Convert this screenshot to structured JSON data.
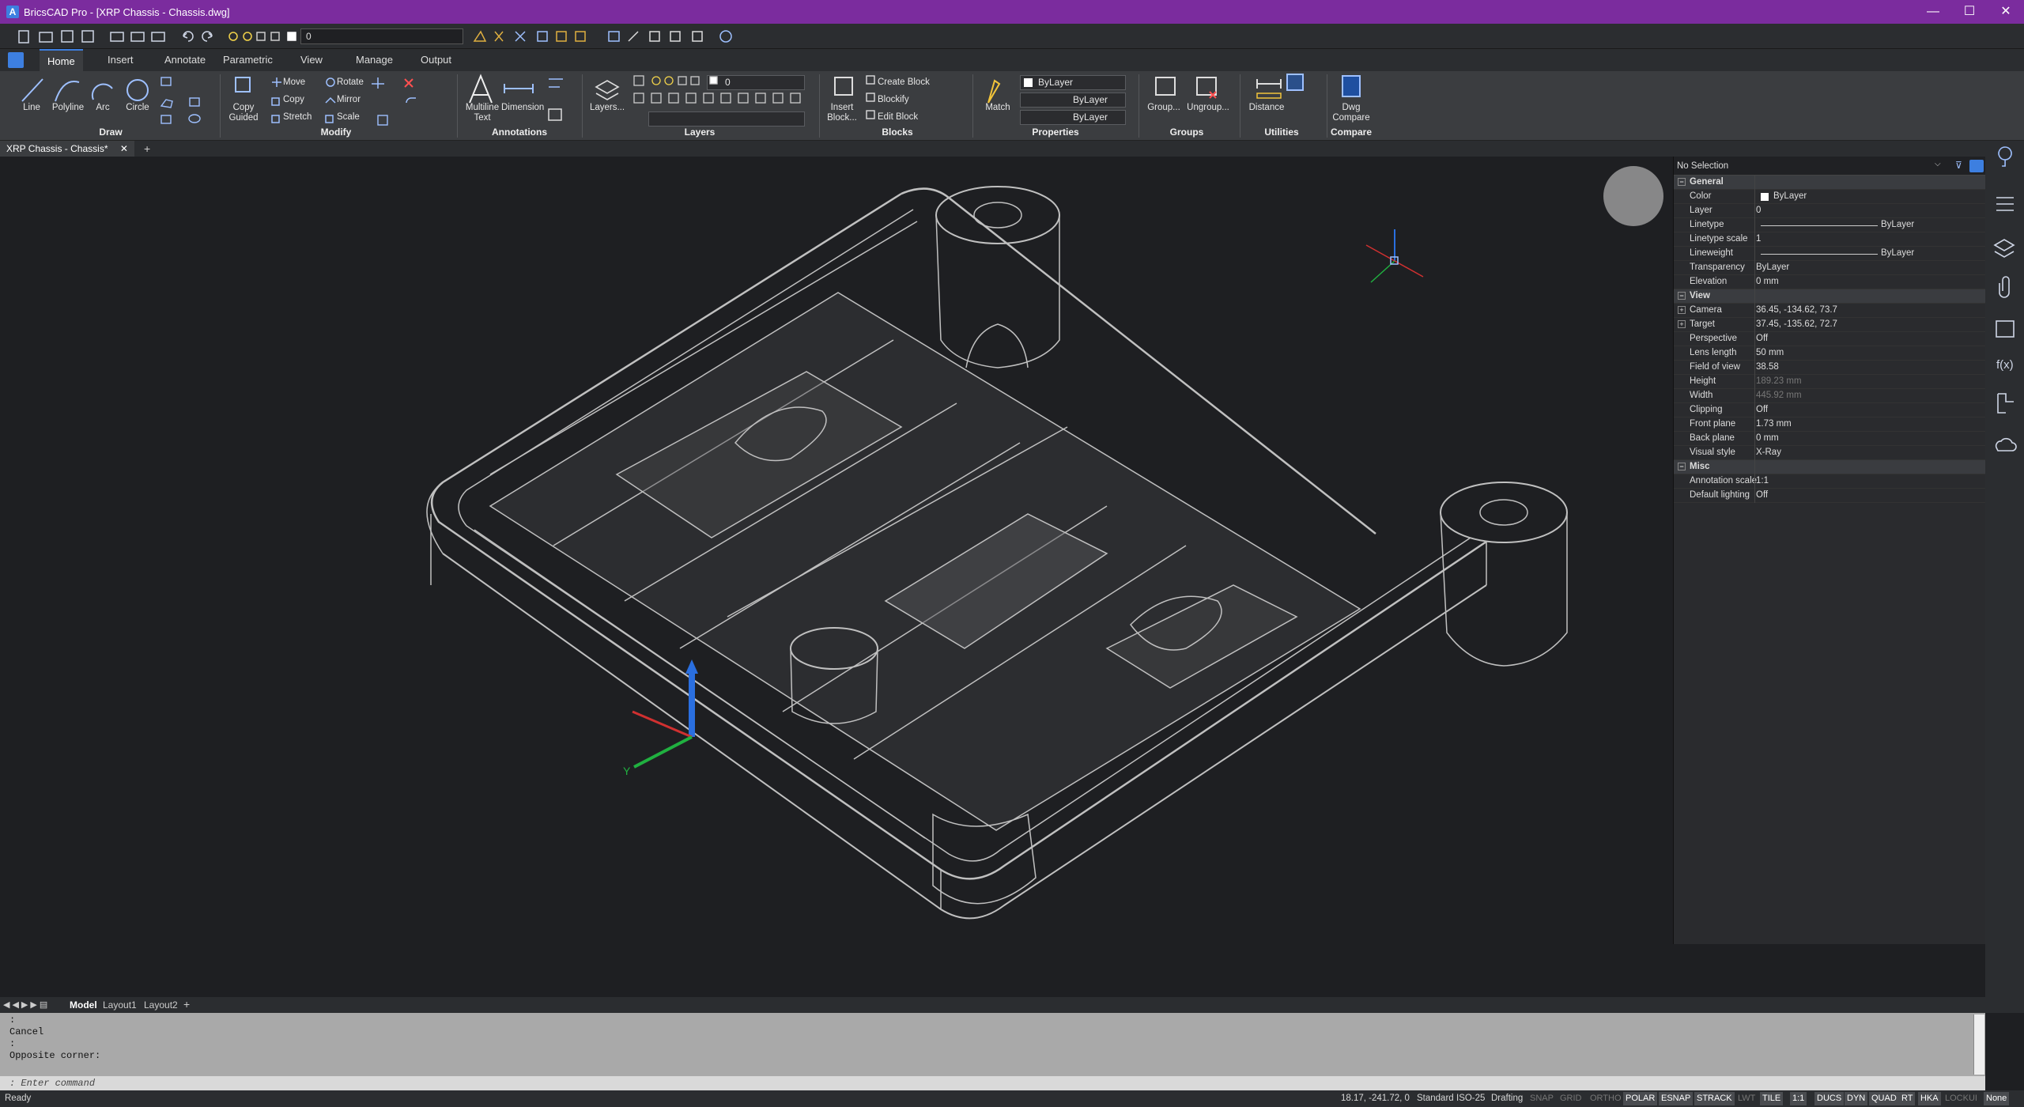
{
  "window": {
    "title": "BricsCAD Pro - [XRP Chassis - Chassis.dwg]",
    "minimize": "—",
    "maximize": "☐",
    "close": "✕"
  },
  "qat": {
    "layer_value": "0"
  },
  "tabs": [
    {
      "label": "Home"
    },
    {
      "label": "Insert"
    },
    {
      "label": "Annotate"
    },
    {
      "label": "Parametric"
    },
    {
      "label": "View"
    },
    {
      "label": "Manage"
    },
    {
      "label": "Output"
    }
  ],
  "ribbon": {
    "panels": {
      "draw": "Draw",
      "modify": "Modify",
      "annotations": "Annotations",
      "layers": "Layers",
      "blocks": "Blocks",
      "properties": "Properties",
      "groups": "Groups",
      "utilities": "Utilities",
      "compare": "Compare"
    },
    "draw": {
      "line": "Line",
      "polyline": "Polyline",
      "arc": "Arc",
      "circle": "Circle"
    },
    "modify": {
      "copy_guided": "Copy\nGuided",
      "move": "Move",
      "copy": "Copy",
      "stretch": "Stretch",
      "rotate": "Rotate",
      "mirror": "Mirror",
      "scale": "Scale"
    },
    "annotations": {
      "multiline": "Multiline\nText",
      "dimension": "Dimension"
    },
    "layers": {
      "layers_btn": "Layers...",
      "layer_value": "0"
    },
    "blocks": {
      "insert": "Insert\nBlock...",
      "create": "Create Block",
      "blockify": "Blockify",
      "edit": "Edit Block"
    },
    "properties": {
      "match": "Match",
      "color": "ByLayer",
      "linetype": "ByLayer",
      "lineweight": "ByLayer"
    },
    "groups": {
      "group": "Group...",
      "ungroup": "Ungroup..."
    },
    "utilities": {
      "distance": "Distance"
    },
    "compare": {
      "dwg": "Dwg\nCompare"
    }
  },
  "document_tab": {
    "label": "XRP Chassis - Chassis*"
  },
  "properties": {
    "selection": "No Selection",
    "sections": [
      {
        "name": "General",
        "rows": [
          {
            "k": "Color",
            "v": "ByLayer"
          },
          {
            "k": "Layer",
            "v": "0"
          },
          {
            "k": "Linetype",
            "v": "ByLayer"
          },
          {
            "k": "Linetype scale",
            "v": "1"
          },
          {
            "k": "Lineweight",
            "v": "ByLayer"
          },
          {
            "k": "Transparency",
            "v": "ByLayer"
          },
          {
            "k": "Elevation",
            "v": "0 mm"
          }
        ]
      },
      {
        "name": "View",
        "rows": [
          {
            "k": "Camera",
            "v": "36.45, -134.62, 73.7"
          },
          {
            "k": "Target",
            "v": "37.45, -135.62, 72.7"
          },
          {
            "k": "Perspective",
            "v": "Off"
          },
          {
            "k": "Lens length",
            "v": "50 mm"
          },
          {
            "k": "Field of view",
            "v": "38.58"
          },
          {
            "k": "Height",
            "v": "189.23 mm"
          },
          {
            "k": "Width",
            "v": "445.92 mm"
          },
          {
            "k": "Clipping",
            "v": "Off"
          },
          {
            "k": "Front plane",
            "v": "1.73 mm"
          },
          {
            "k": "Back plane",
            "v": "0 mm"
          },
          {
            "k": "Visual style",
            "v": "X-Ray"
          }
        ]
      },
      {
        "name": "Misc",
        "rows": [
          {
            "k": "Annotation scale",
            "v": "1:1"
          },
          {
            "k": "Default lighting",
            "v": "Off"
          }
        ]
      }
    ]
  },
  "layout_tabs": [
    {
      "label": "Model"
    },
    {
      "label": "Layout1"
    },
    {
      "label": "Layout2"
    }
  ],
  "command_history": [
    ":",
    "Cancel",
    ":",
    "Opposite corner:"
  ],
  "command_prompt": ": Enter command",
  "status": {
    "ready": "Ready",
    "coords": "18.17, -241.72, 0",
    "style": "Standard",
    "dimstyle": "ISO-25",
    "workspace": "Drafting",
    "toggles": [
      {
        "label": "SNAP",
        "on": false
      },
      {
        "label": "GRID",
        "on": false
      },
      {
        "label": "ORTHO",
        "on": false
      },
      {
        "label": "POLAR",
        "on": true
      },
      {
        "label": "ESNAP",
        "on": true
      },
      {
        "label": "STRACK",
        "on": true
      },
      {
        "label": "LWT",
        "on": false
      },
      {
        "label": "TILE",
        "on": true
      },
      {
        "label": "1:1",
        "on": true
      },
      {
        "label": "DUCS",
        "on": true
      },
      {
        "label": "DYN",
        "on": true
      },
      {
        "label": "QUAD",
        "on": true
      },
      {
        "label": "RT",
        "on": true
      },
      {
        "label": "HKA",
        "on": true
      },
      {
        "label": "LOCKUI",
        "on": false
      },
      {
        "label": "None",
        "on": true
      }
    ]
  },
  "colors": {
    "titlebar": "#7b2c9e",
    "accent": "#3d7fe0",
    "ucs_x": "#d03030",
    "ucs_y": "#20b040",
    "ucs_z": "#2a6fe0"
  }
}
